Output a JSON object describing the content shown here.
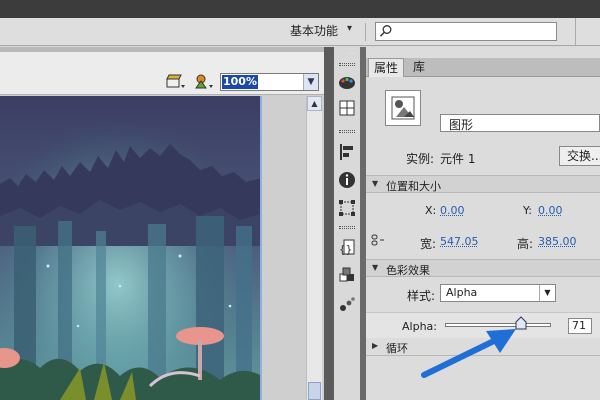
{
  "menubar": {
    "workspace": "基本功能",
    "search_placeholder": ""
  },
  "stage": {
    "zoom": "100%"
  },
  "panel": {
    "tabs": [
      "属性",
      "库"
    ],
    "symbol_type": "图形",
    "instance_label": "实例:",
    "instance_name": "元件 1",
    "swap_label": "交换...",
    "position_section": "位置和大小",
    "x_label": "X:",
    "x_value": "0.00",
    "y_label": "Y:",
    "y_value": "0.00",
    "width_label": "宽:",
    "width_value": "547.05",
    "height_label": "高:",
    "height_value": "385.00",
    "color_section": "色彩效果",
    "style_label": "样式:",
    "style_value": "Alpha",
    "alpha_label": "Alpha:",
    "alpha_value": "71",
    "loop_section": "循环"
  },
  "annotation_color": "#1f6fd6",
  "icons": [
    "search-icon",
    "scene-icon",
    "symbol-icon",
    "color-swatches-icon",
    "align-icon",
    "info-icon",
    "transform-icon",
    "code-snippet-icon",
    "components-icon",
    "motion-presets-icon",
    "link-chain-icon"
  ]
}
